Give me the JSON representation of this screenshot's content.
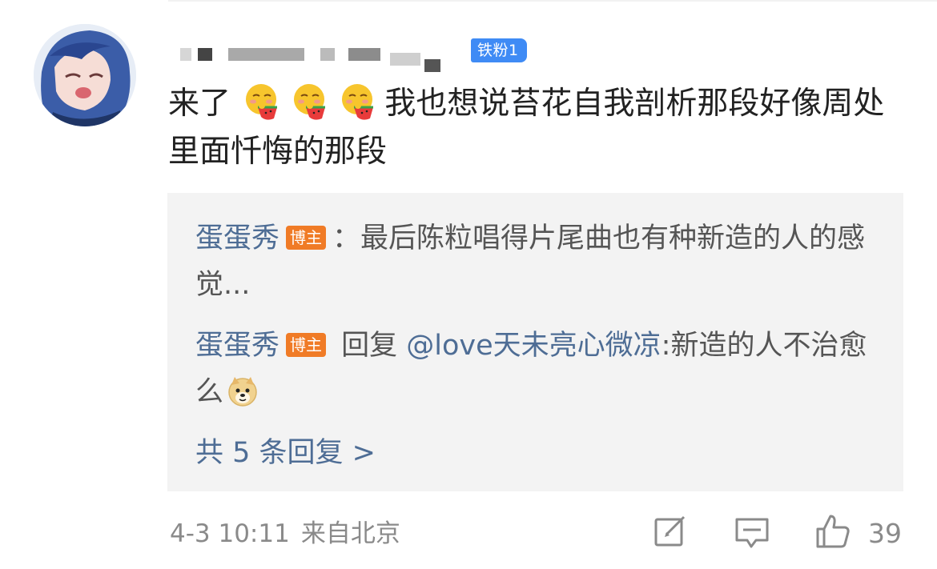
{
  "comment": {
    "fans_badge": "铁粉1",
    "text_before_emoji": "来了",
    "emoji_name": "watermelon-face-emoji",
    "text_after_emoji": "我也想说苔花自我剖析那段好像周处里面忏悔的那段"
  },
  "replies": [
    {
      "author": "蛋蛋秀",
      "badge": "博主",
      "separator": "：",
      "text": "最后陈粒唱得片尾曲也有种新造的人的感觉..."
    },
    {
      "author": "蛋蛋秀",
      "badge": "博主",
      "reply_word": " 回复 ",
      "mention": "@love天未亮心微凉",
      "text": ":新造的人不治愈么",
      "emoji_name": "doge-emoji"
    }
  ],
  "more_replies": "共 5 条回复 >",
  "meta": {
    "time": "4-3 10:11",
    "location": "来自北京"
  },
  "actions": {
    "like_count": "39",
    "icons": [
      "edit-icon",
      "comment-icon",
      "like-icon"
    ]
  },
  "colors": {
    "link_blue": "#4e6d95",
    "fans_badge_bg": "#3f8bf5",
    "owner_badge_bg": "#f07b26",
    "reply_bg": "#f3f3f3"
  }
}
